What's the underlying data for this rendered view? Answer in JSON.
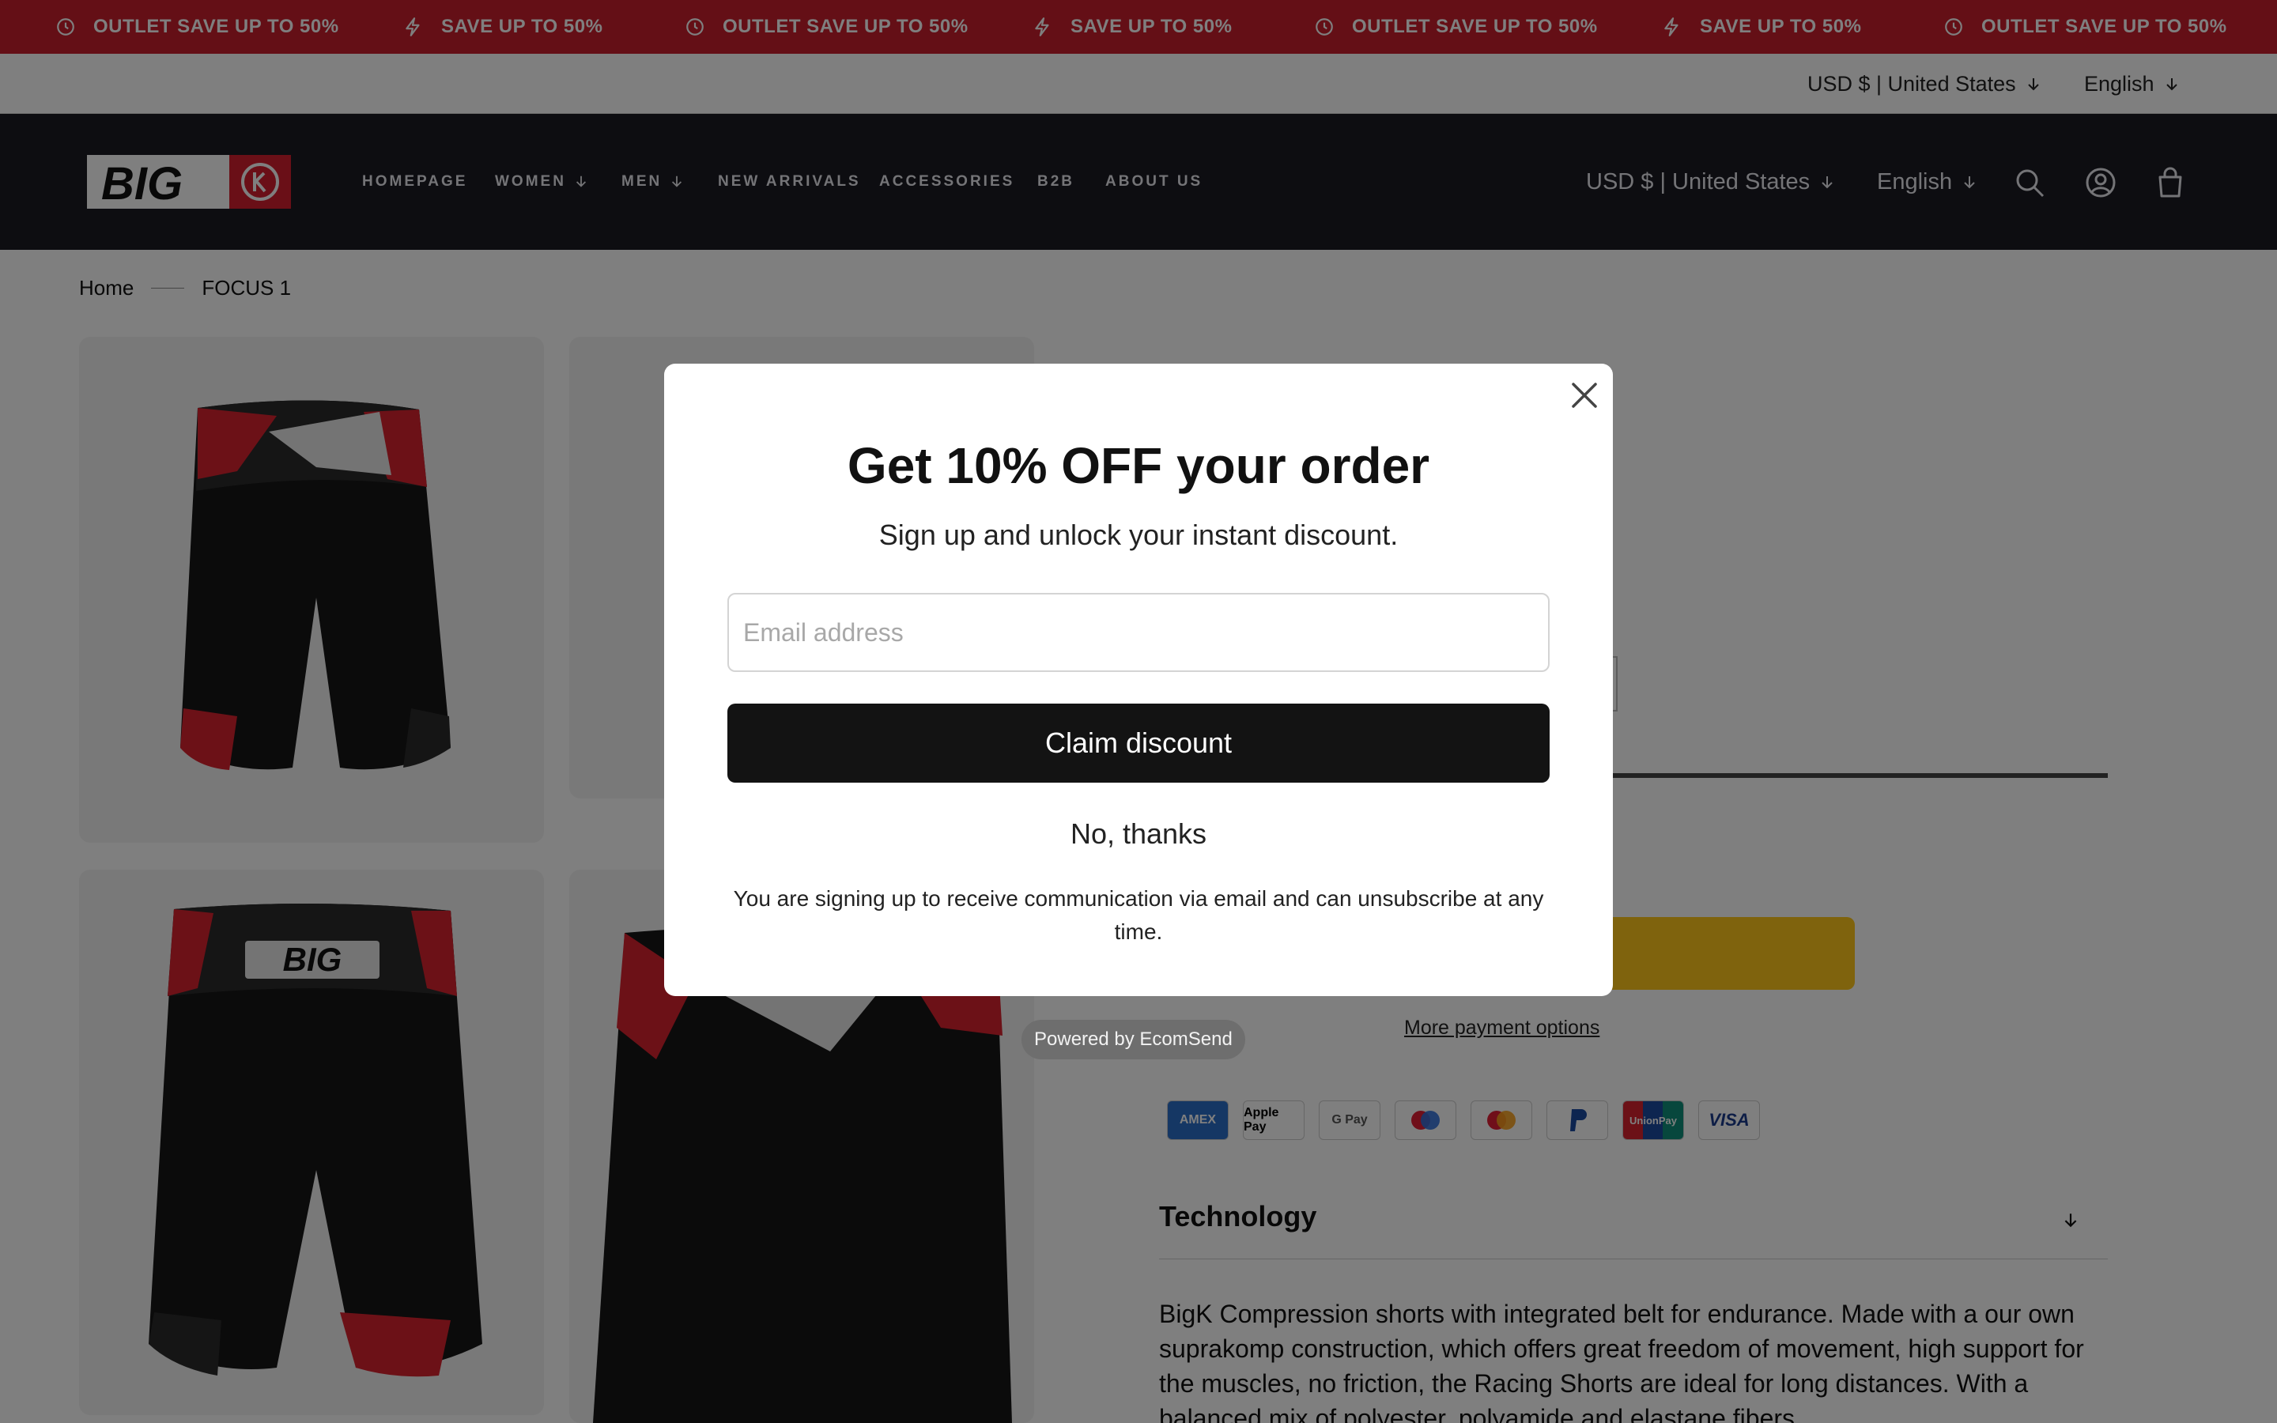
{
  "announcement": {
    "items": [
      {
        "icon": "clock-icon",
        "text": "OUTLET SAVE UP TO 50%"
      },
      {
        "icon": "lightning-icon",
        "text": "SAVE UP TO 50%"
      },
      {
        "icon": "clock-icon",
        "text": "OUTLET SAVE UP TO 50%"
      },
      {
        "icon": "lightning-icon",
        "text": "SAVE UP TO 50%"
      },
      {
        "icon": "clock-icon",
        "text": "OUTLET SAVE UP TO 50%"
      },
      {
        "icon": "lightning-icon",
        "text": "SAVE UP TO 50%"
      },
      {
        "icon": "clock-icon",
        "text": "OUTLET SAVE UP TO 50%"
      }
    ]
  },
  "utility": {
    "currency": "USD $ | United States",
    "language": "English"
  },
  "header": {
    "logo_text": "BIG",
    "nav": [
      {
        "label": "HOMEPAGE",
        "has_dropdown": false
      },
      {
        "label": "WOMEN",
        "has_dropdown": true
      },
      {
        "label": "MEN",
        "has_dropdown": true
      },
      {
        "label": "NEW ARRIVALS",
        "has_dropdown": false
      },
      {
        "label": "ACCESSORIES",
        "has_dropdown": false
      },
      {
        "label": "B2B",
        "has_dropdown": false
      },
      {
        "label": "ABOUT US",
        "has_dropdown": false
      }
    ],
    "currency": "USD $ | United States",
    "language": "English",
    "icons": [
      "search-icon",
      "account-icon",
      "cart-icon"
    ]
  },
  "breadcrumb": {
    "home": "Home",
    "current": "FOCUS 1"
  },
  "product": {
    "gallery_logo_text": "BIG",
    "more_payment_options": "More payment options",
    "payment_methods": [
      "AMEX",
      "Apple Pay",
      "G Pay",
      "Maestro",
      "Mastercard",
      "PayPal",
      "UnionPay",
      "VISA"
    ],
    "accordion_title": "Technology",
    "description": "BigK Compression shorts with integrated belt for endurance. Made with a our own suprakomp construction, which offers great freedom of movement, high support for the muscles, no friction, the Racing Shorts are ideal for long distances. With a balanced mix of polyester, polyamide and elastane fibers"
  },
  "modal": {
    "title": "Get 10% OFF your order",
    "subtitle": "Sign up and unlock your instant discount.",
    "email_placeholder": "Email address",
    "email_value": "",
    "claim_label": "Claim discount",
    "decline_label": "No, thanks",
    "disclaimer": "You are signing up to receive communication via email and can unsubscribe at any time."
  },
  "powered_by": "Powered by EcomSend",
  "colors": {
    "announcement_bg": "#c81e2c",
    "header_bg": "#1a1a22",
    "buy_button": "#ffc61a",
    "claim_button": "#131313"
  }
}
